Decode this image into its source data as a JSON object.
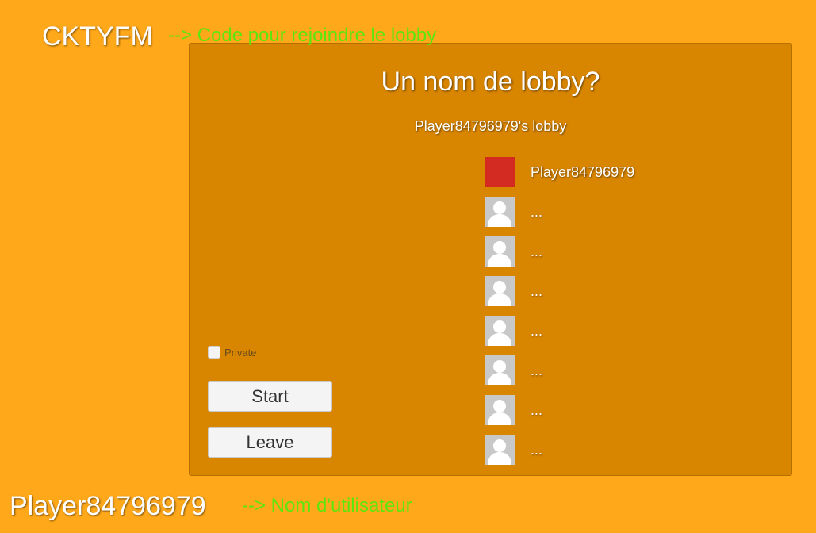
{
  "lobby_code": "CKTYFM",
  "code_annotation": "--> Code pour rejoindre le lobby",
  "panel": {
    "title": "Un nom de lobby?",
    "lobby_name": "Player84796979's lobby",
    "private_label": "Private",
    "private_checked": false,
    "start_label": "Start",
    "leave_label": "Leave"
  },
  "players": [
    {
      "name": "Player84796979",
      "avatar": "red-color-swatch",
      "color": "#D32A22"
    },
    {
      "name": "...",
      "avatar": "user-silhouette-icon"
    },
    {
      "name": "...",
      "avatar": "user-silhouette-icon"
    },
    {
      "name": "...",
      "avatar": "user-silhouette-icon"
    },
    {
      "name": "...",
      "avatar": "user-silhouette-icon"
    },
    {
      "name": "...",
      "avatar": "user-silhouette-icon"
    },
    {
      "name": "...",
      "avatar": "user-silhouette-icon"
    },
    {
      "name": "...",
      "avatar": "user-silhouette-icon"
    }
  ],
  "username": "Player84796979",
  "username_annotation": "--> Nom d'utilisateur",
  "colors": {
    "background": "#FFA81A",
    "panel": "#D88500",
    "annotation": "#5CE60A",
    "self_player": "#D32A22",
    "empty_slot": "#C8C8C8"
  }
}
